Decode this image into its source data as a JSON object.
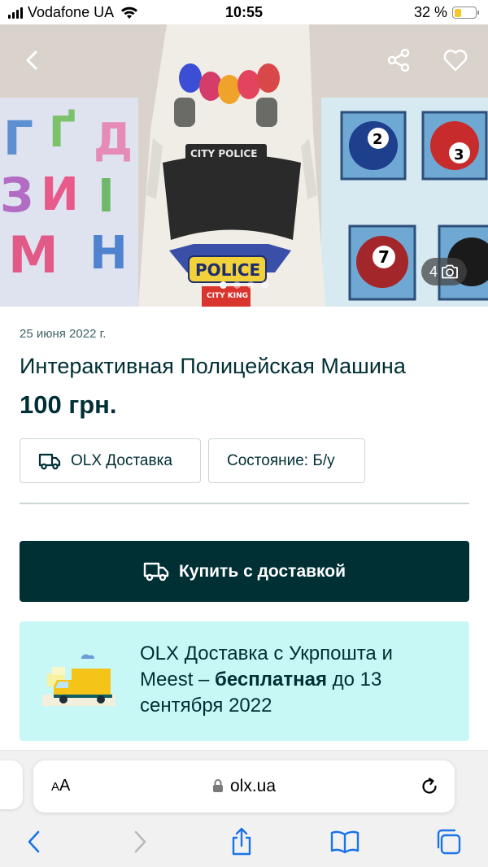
{
  "status_bar": {
    "carrier": "Vodafone UA",
    "time": "10:55",
    "battery_percent": "32 %",
    "battery_level": 0.32
  },
  "gallery": {
    "photo_count": "4",
    "active_index": 0,
    "total": 4
  },
  "listing": {
    "date": "25 июня 2022 г.",
    "title": "Интерактивная Полицейская Машина",
    "price": "100 грн.",
    "delivery_chip": "OLX Доставка",
    "condition_chip": "Состояние: Б/у",
    "buy_button": "Купить с доставкой"
  },
  "promo": {
    "text_before": "OLX Доставка с Укрпошта и Meest – ",
    "text_bold": "бесплатная",
    "text_after": " до 13 сентября 2022"
  },
  "browser": {
    "aa_label_small": "A",
    "aa_label_large": "A",
    "url": "olx.ua"
  },
  "colors": {
    "primary": "#002f34",
    "promo_bg": "#c8f8f6",
    "chip_border": "#cdd5d6"
  }
}
